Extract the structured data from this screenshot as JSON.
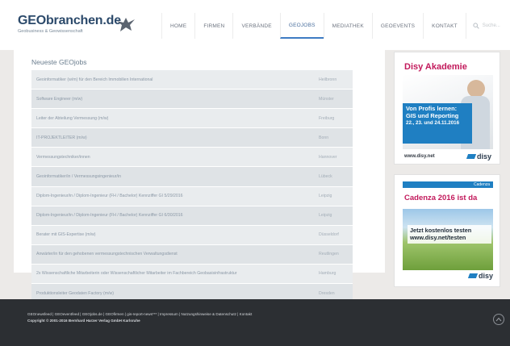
{
  "site": {
    "logo_title": "GEObranchen.de",
    "logo_subtitle": "Geobusiness & Geowissenschaft"
  },
  "nav": {
    "items": [
      {
        "label": "HOME"
      },
      {
        "label": "FIRMEN"
      },
      {
        "label": "VERBÄNDE"
      },
      {
        "label": "GEOJOBS"
      },
      {
        "label": "MEDIATHEK"
      },
      {
        "label": "GEOEVENTS"
      },
      {
        "label": "KONTAKT"
      }
    ],
    "active": "GEOJOBS",
    "search_placeholder": "Suche..."
  },
  "jobs": {
    "title": "Neueste GEOjobs",
    "rows": [
      {
        "title": "Geoinformatiker (w/m) für den Bereich Immobilien International",
        "city": "Heilbronn"
      },
      {
        "title": "Software Engineer (m/w)",
        "city": "Münster"
      },
      {
        "title": "Leiter der Abteilung Vermessung (m/w)",
        "city": "Freiburg"
      },
      {
        "title": "IT-PROJEKTLEITER (m/w)",
        "city": "Bonn"
      },
      {
        "title": "Vermessungstechniker/innen",
        "city": "Hannover"
      },
      {
        "title": "Geoinformatiker/in / Vermessungsingenieur/in",
        "city": "Lübeck"
      },
      {
        "title": "Diplom-Ingenieur/in / Diplom-Ingenieur (FH / Bachelor) Kennziffer GI 5/29/2016",
        "city": "Leipzig"
      },
      {
        "title": "Diplom-Ingenieur/in / Diplom-Ingenieur (FH / Bachelor) Kennziffer GI 6/30/2016",
        "city": "Leipzig"
      },
      {
        "title": "Berater mit GIS-Expertise (m/w)",
        "city": "Düsseldorf"
      },
      {
        "title": "Anwärter/in für den gehobenen vermessungstechnischen Verwaltungsdienst",
        "city": "Reutlingen"
      },
      {
        "title": "2x Wissenschaftliche Mitarbeiterin oder Wissenschaftlicher Mitarbeiter im Fachbereich Geobasisinfrastruktur",
        "city": "Hamburg"
      },
      {
        "title": "Produktionsleiter Geodaten Factory (m/w)",
        "city": "Dresden"
      }
    ]
  },
  "ads": {
    "akademie": {
      "title": "Disy Akademie",
      "banner_line1": "Von Profis lernen:",
      "banner_line2": "GIS und Reporting",
      "banner_line3": "22., 23. und 24.11.2016",
      "url": "www.disy.net",
      "brand": "disy"
    },
    "cadenza": {
      "bar": "Cadenza",
      "title": "Cadenza 2016 ist da",
      "text_line1": "Jetzt kostenlos testen",
      "text_line2": "www.disy.net/testen",
      "brand": "disy"
    }
  },
  "footer": {
    "links": "GEOnewsfeed | GEOeventfeed | GEOjobs.de | GEOfirmen | gis-report-news*** | Impressum | Nutzungshinweise & Datenschutz | Kontakt",
    "copyright": "Copyright © 2001-2016 Bernhard Harzer Verlag GmbH Karlsruhe"
  },
  "colors": {
    "accent": "#3e7bc3",
    "brand_magenta": "#c2195b",
    "footer_bg": "#2c2f33"
  }
}
